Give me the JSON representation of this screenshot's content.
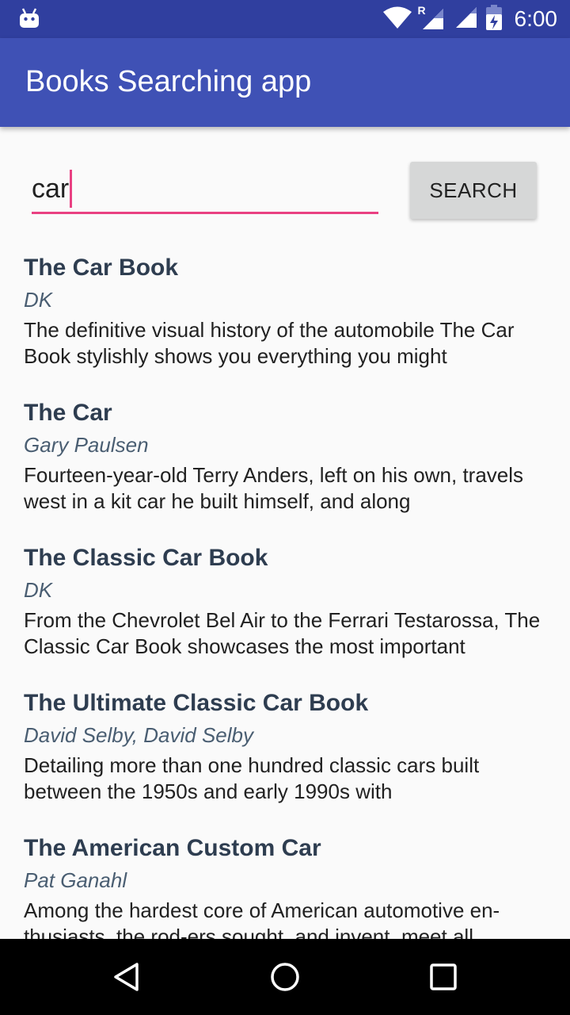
{
  "status_bar": {
    "time": "6:00",
    "roaming_indicator": "R",
    "icons": [
      "android-icon",
      "wifi-icon",
      "signal-roaming-icon",
      "signal-icon",
      "battery-icon"
    ]
  },
  "app_bar": {
    "title": "Books Searching app",
    "color": "#3F51B5"
  },
  "search": {
    "value": "car",
    "button_label": "SEARCH",
    "accent_color": "#E94082"
  },
  "books": [
    {
      "title": "The Car Book",
      "author": "DK",
      "description": "The definitive visual history of the automobile The Car Book stylishly shows you everything you might"
    },
    {
      "title": "The Car",
      "author": "Gary Paulsen",
      "description": "Fourteen-year-old Terry Anders, left on his own, travels west in a kit car he built himself, and along"
    },
    {
      "title": "The Classic Car Book",
      "author": "DK",
      "description": "From the Chevrolet Bel Air to the Ferrari Testarossa, The Classic Car Book showcases the most important"
    },
    {
      "title": "The Ultimate Classic Car Book",
      "author": "David Selby, David Selby",
      "description": "Detailing more than one hundred classic cars built between the 1950s and early 1990s with"
    },
    {
      "title": "The American Custom Car",
      "author": "Pat Ganahl",
      "description": "Among the hardest core of American automotive en-thusiasts, the rod-ers sought, and invent, meet all"
    }
  ],
  "nav_bar": {
    "icons": [
      "back-icon",
      "home-icon",
      "recents-icon"
    ]
  }
}
